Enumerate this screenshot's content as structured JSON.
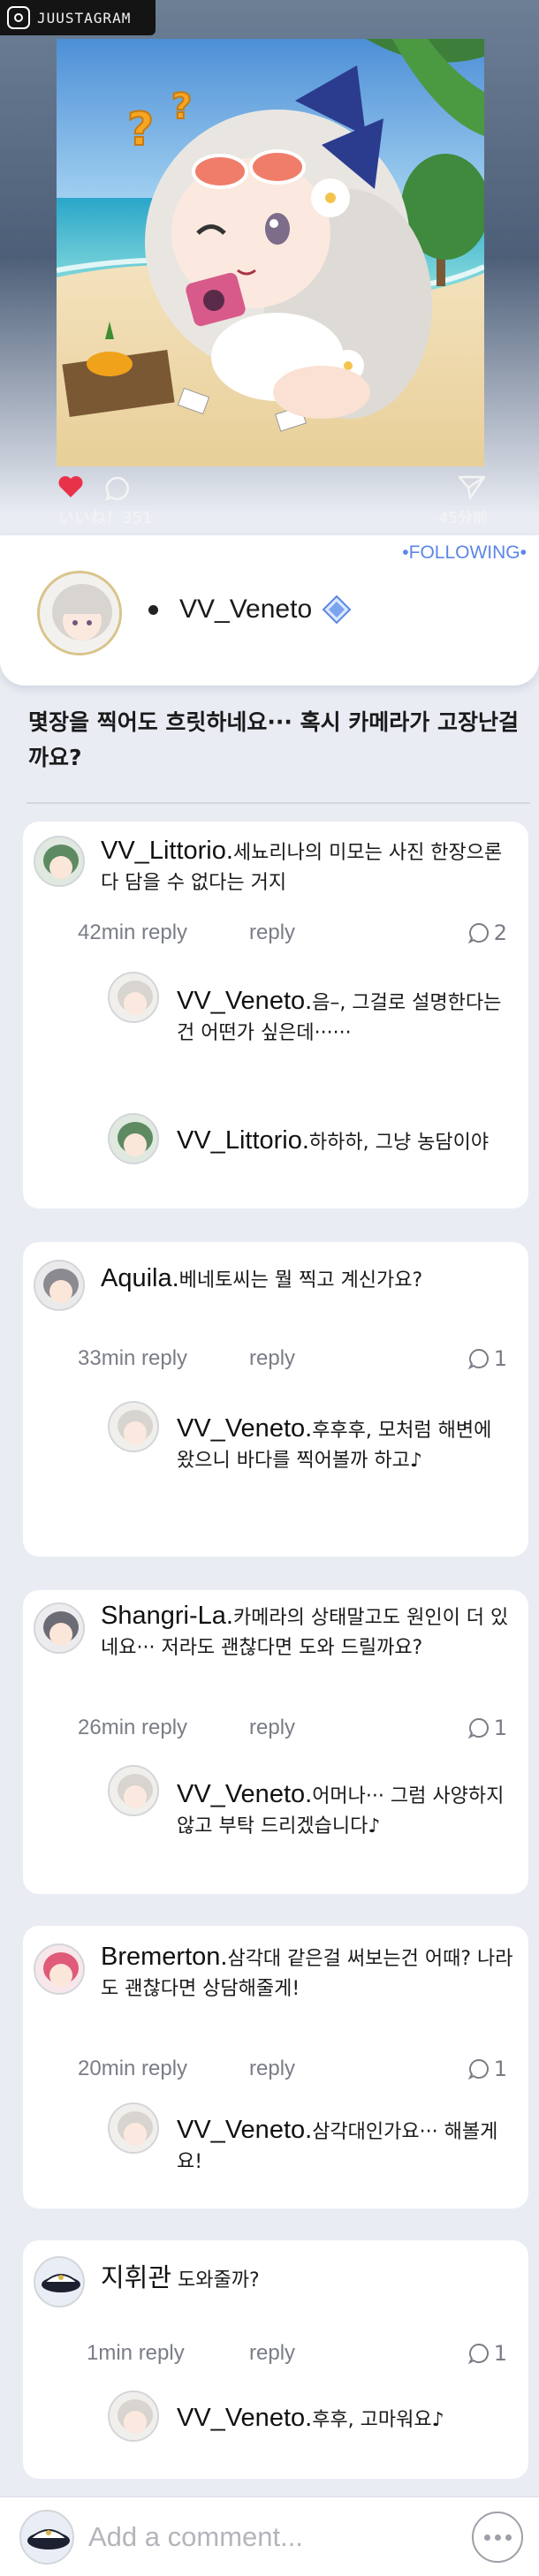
{
  "app": {
    "brand": "JUUSTAGRAM"
  },
  "post": {
    "likes": "いいね！351",
    "time_ago": "45分前",
    "following_label": "•FOLLOWING•",
    "author": "VV_Veneto",
    "caption": "몇장을 찍어도 흐릿하네요··· 혹시 카메라가 고장난걸까요?"
  },
  "comments": [
    {
      "name": "VV_Littorio.",
      "text": "세뇨리나의 미모는 사진 한장으론 다 담을 수 없다는 거지",
      "time": "42min reply",
      "reply": "reply",
      "reply_count": "2",
      "replies": [
        {
          "name": "VV_Veneto.",
          "text": "음–, 그걸로 설명한다는건 어떤가 싶은데······"
        },
        {
          "name": "VV_Littorio.",
          "text": "하하하, 그냥 농담이야"
        }
      ]
    },
    {
      "name": "Aquila.",
      "text": "베네토씨는 뭘 찍고 계신가요?",
      "time": "33min reply",
      "reply": "reply",
      "reply_count": "1",
      "replies": [
        {
          "name": "VV_Veneto.",
          "text": "후후후, 모처럼 해변에 왔으니 바다를 찍어볼까 하고♪"
        }
      ]
    },
    {
      "name": "Shangri-La.",
      "text": "카메라의 상태말고도 원인이 더 있네요··· 저라도 괜찮다면 도와 드릴까요?",
      "time": "26min reply",
      "reply": "reply",
      "reply_count": "1",
      "replies": [
        {
          "name": "VV_Veneto.",
          "text": "어머나··· 그럼 사양하지 않고 부탁 드리겠습니다♪"
        }
      ]
    },
    {
      "name": "Bremerton.",
      "text": "삼각대 같은걸 써보는건 어때? 나라도 괜찮다면 상담해줄게!",
      "time": "20min reply",
      "reply": "reply",
      "reply_count": "1",
      "replies": [
        {
          "name": "VV_Veneto.",
          "text": "삼각대인가요··· 해볼게요!"
        }
      ]
    },
    {
      "name": "지휘관",
      "text": "도와줄까?",
      "time": "1min reply",
      "reply": "reply",
      "reply_count": "1",
      "replies": [
        {
          "name": "VV_Veneto.",
          "text": "후후, 고마워요♪"
        }
      ]
    }
  ],
  "comment_bar": {
    "placeholder": "Add a comment..."
  },
  "colors": {
    "accent": "#5b86e8",
    "heart": "#e8324a",
    "meta_gray": "#7a7d86",
    "background": "#e9ecf3"
  },
  "icons": [
    "camera-logo-icon",
    "heart-icon",
    "comment-bubble-icon",
    "send-icon",
    "verified-diamond-icon",
    "reply-bubble-icon",
    "chat-dots-icon"
  ]
}
